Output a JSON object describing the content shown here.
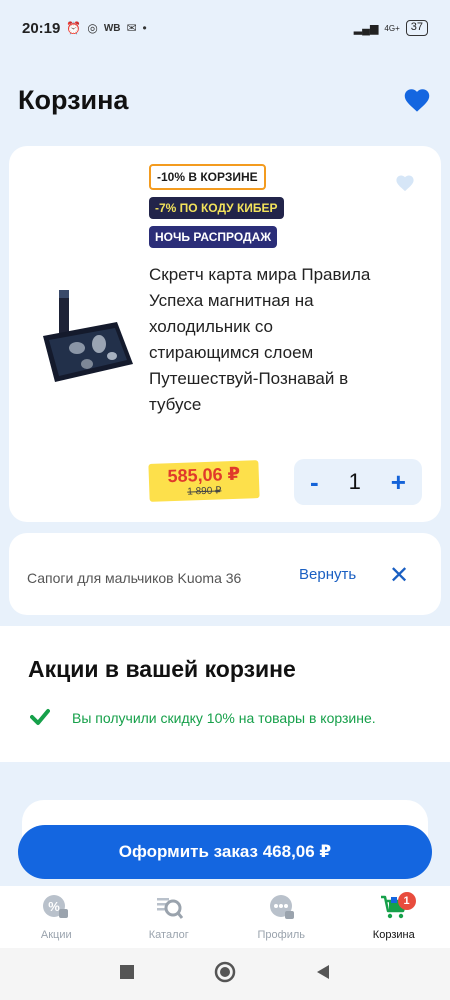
{
  "status": {
    "time": "20:19",
    "wb": "WB",
    "dot": "•",
    "network": "4G+",
    "battery": "37"
  },
  "header": {
    "title": "Корзина"
  },
  "product": {
    "badges": [
      "-10% В КОРЗИНЕ",
      "-7% ПО КОДУ КИБЕР",
      "НОЧЬ РАСПРОДАЖ"
    ],
    "title": "Скретч карта мира Правила Успеха магнитная на холодильник со стирающимся слоем Путешествуй-Познавай в тубусе",
    "price_now": "585,06 ₽",
    "price_old": "1 890 ₽",
    "quantity": "1",
    "minus": "-",
    "plus": "+"
  },
  "removed": {
    "text": "Сапоги для мальчиков Kuoma 36",
    "undo_label": "Вернуть",
    "close": "✕"
  },
  "promo": {
    "title": "Акции в вашей корзине",
    "message": "Вы получили скидку 10% на товары в корзине."
  },
  "checkout": {
    "label": "Оформить заказ 468,06 ₽"
  },
  "nav": {
    "items": [
      {
        "label": "Акции",
        "icon": "percent-tag-icon"
      },
      {
        "label": "Каталог",
        "icon": "catalog-search-icon"
      },
      {
        "label": "Профиль",
        "icon": "profile-chat-icon"
      },
      {
        "label": "Корзина",
        "icon": "cart-icon",
        "badge": "1"
      }
    ]
  },
  "colors": {
    "accent": "#1466e0",
    "background": "#e8f1fb",
    "price": "#e03a2b",
    "price_bg": "#fde04b",
    "success": "#16a04a",
    "badge_count": "#e84c3d"
  }
}
